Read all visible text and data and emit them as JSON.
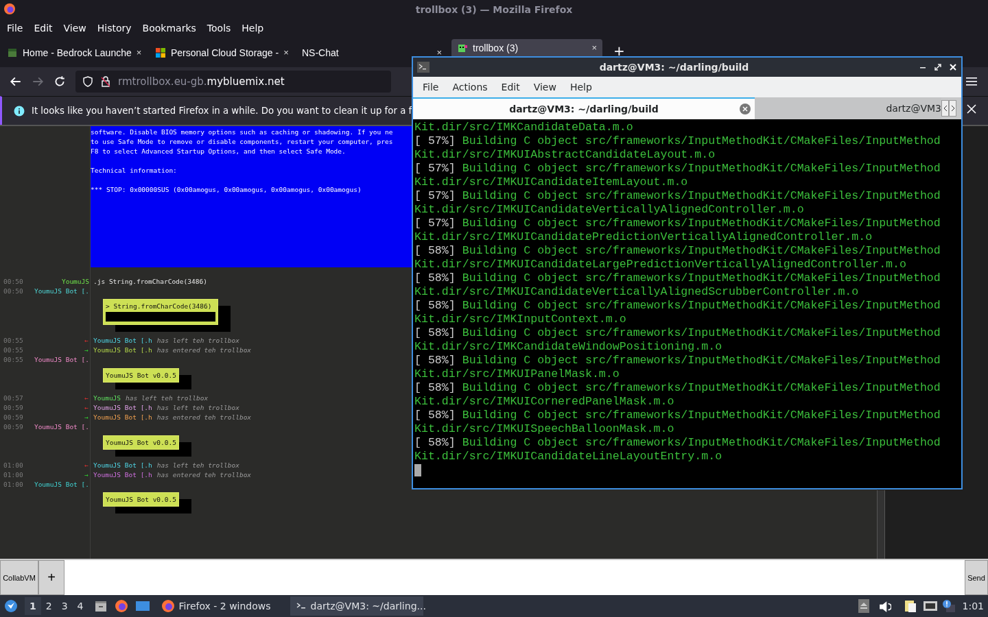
{
  "firefox": {
    "title": "trollbox (3) — Mozilla Firefox",
    "menu": [
      "File",
      "Edit",
      "View",
      "History",
      "Bookmarks",
      "Tools",
      "Help"
    ],
    "tabs": [
      {
        "label": "Home - Bedrock Launche",
        "close": "×",
        "selected": false
      },
      {
        "label": "Personal Cloud Storage -",
        "close": "×",
        "selected": false
      },
      {
        "label": "NS-Chat",
        "close": "×",
        "selected": false
      },
      {
        "label": "trollbox (3)",
        "close": "×",
        "selected": true
      }
    ],
    "new_tab": "+",
    "url_prefix": "rmtrollbox.eu-gb.",
    "url_domain": "mybluemix.net",
    "notice": "It looks like you haven’t started Firefox in a while. Do you want to clean it up for a f"
  },
  "chat": {
    "bsod_paragraphs": [
      [
        "software. Disable BIOS memory options such as caching or shadowing. If you ne",
        "to use Safe Mode to remove or disable components, restart your computer, pres",
        "F8 to select Advanced Startup Options, and then select Safe Mode."
      ],
      [
        "Technical information:"
      ],
      [
        "*** STOP: 0x00000SUS (0x00amogus, 0x00amogus, 0x00amogus, 0x00amogus)"
      ]
    ],
    "rows": [
      {
        "kind": "message",
        "time": "00:50",
        "name": "YoumuJS",
        "color": "#6ee04a",
        "text": ".js String.fromCharCode(3486)"
      },
      {
        "kind": "message",
        "time": "00:50",
        "name": "YoumuJS Bot [.",
        "color": "#4fd6d6",
        "text": ""
      },
      {
        "kind": "console",
        "text": "> String.fromCharCode(3486)"
      },
      {
        "kind": "left",
        "time": "00:55",
        "arrow": "←",
        "name": "YoumuJS Bot [.h",
        "color": "#4fd6e6",
        "text": "has left teh trollbox"
      },
      {
        "kind": "entered",
        "time": "00:55",
        "arrow": "→",
        "name": "YoumuJS Bot [.h",
        "color": "#b4d84a",
        "text": "has entered teh trollbox"
      },
      {
        "kind": "message",
        "time": "00:55",
        "name": "YoumuJS Bot [.",
        "color": "#f08ac8",
        "text": ""
      },
      {
        "kind": "card",
        "text": "YoumuJS Bot v0.0.5"
      },
      {
        "kind": "left",
        "time": "00:57",
        "arrow": "←",
        "name": "YoumuJS",
        "color": "#5fe05f",
        "text": "has left teh trollbox"
      },
      {
        "kind": "left",
        "time": "00:59",
        "arrow": "←",
        "name": "YoumuJS Bot [.h",
        "color": "#e0a0e8",
        "text": "has left teh trollbox"
      },
      {
        "kind": "entered",
        "time": "00:59",
        "arrow": "→",
        "name": "YoumuJS Bot [.h",
        "color": "#f0a050",
        "text": "has entered teh trollbox"
      },
      {
        "kind": "message",
        "time": "00:59",
        "name": "YoumuJS Bot [.",
        "color": "#f08ac8",
        "text": ""
      },
      {
        "kind": "card",
        "text": "YoumuJS Bot v0.0.5"
      },
      {
        "kind": "left",
        "time": "01:00",
        "arrow": "←",
        "name": "YoumuJS Bot [.h",
        "color": "#4fd6e6",
        "text": "has left teh trollbox"
      },
      {
        "kind": "entered",
        "time": "01:00",
        "arrow": "→",
        "name": "YoumuJS Bot [.h",
        "color": "#d070e0",
        "text": "has entered teh trollbox"
      },
      {
        "kind": "message",
        "time": "01:00",
        "name": "YoumuJS Bot [.",
        "color": "#40d0d0",
        "text": ""
      },
      {
        "kind": "card",
        "text": "YoumuJS Bot v0.0.5"
      }
    ],
    "room_button": "CollabVM",
    "add_button": "+",
    "send_button": "Send"
  },
  "terminal": {
    "title": "dartz@VM3: ~/darling/build",
    "menu": [
      "File",
      "Actions",
      "Edit",
      "View",
      "Help"
    ],
    "tabs": [
      {
        "label": "dartz@VM3: ~/darling/build",
        "selected": true
      },
      {
        "label": "dartz@VM3",
        "selected": false
      }
    ],
    "lines": [
      {
        "text": "Kit.dir/src/IMKCandidateData.m.o"
      },
      {
        "progress": "[ 57%]",
        "text": "Building C object src/frameworks/InputMethodKit/CMakeFiles/InputMethod"
      },
      {
        "text": "Kit.dir/src/IMKUIAbstractCandidateLayout.m.o"
      },
      {
        "progress": "[ 57%]",
        "text": "Building C object src/frameworks/InputMethodKit/CMakeFiles/InputMethod"
      },
      {
        "text": "Kit.dir/src/IMKUICandidateItemLayout.m.o"
      },
      {
        "progress": "[ 57%]",
        "text": "Building C object src/frameworks/InputMethodKit/CMakeFiles/InputMethod"
      },
      {
        "text": "Kit.dir/src/IMKUICandidateVerticallyAlignedController.m.o"
      },
      {
        "progress": "[ 57%]",
        "text": "Building C object src/frameworks/InputMethodKit/CMakeFiles/InputMethod"
      },
      {
        "text": "Kit.dir/src/IMKUICandidatePredictionVerticallyAlignedController.m.o"
      },
      {
        "progress": "[ 58%]",
        "text": "Building C object src/frameworks/InputMethodKit/CMakeFiles/InputMethod"
      },
      {
        "text": "Kit.dir/src/IMKUICandidateLargePredictionVerticallyAlignedController.m.o"
      },
      {
        "progress": "[ 58%]",
        "text": "Building C object src/frameworks/InputMethodKit/CMakeFiles/InputMethod"
      },
      {
        "text": "Kit.dir/src/IMKUICandidateVerticallyAlignedScrubberController.m.o"
      },
      {
        "progress": "[ 58%]",
        "text": "Building C object src/frameworks/InputMethodKit/CMakeFiles/InputMethod"
      },
      {
        "text": "Kit.dir/src/IMKInputContext.m.o"
      },
      {
        "progress": "[ 58%]",
        "text": "Building C object src/frameworks/InputMethodKit/CMakeFiles/InputMethod"
      },
      {
        "text": "Kit.dir/src/IMKCandidateWindowPositioning.m.o"
      },
      {
        "progress": "[ 58%]",
        "text": "Building C object src/frameworks/InputMethodKit/CMakeFiles/InputMethod"
      },
      {
        "text": "Kit.dir/src/IMKUIPanelMask.m.o"
      },
      {
        "progress": "[ 58%]",
        "text": "Building C object src/frameworks/InputMethodKit/CMakeFiles/InputMethod"
      },
      {
        "text": "Kit.dir/src/IMKUICorneredPanelMask.m.o"
      },
      {
        "progress": "[ 58%]",
        "text": "Building C object src/frameworks/InputMethodKit/CMakeFiles/InputMethod"
      },
      {
        "text": "Kit.dir/src/IMKUISpeechBalloonMask.m.o"
      },
      {
        "progress": "[ 58%]",
        "text": "Building C object src/frameworks/InputMethodKit/CMakeFiles/InputMethod"
      },
      {
        "text": "Kit.dir/src/IMKUICandidateLineLayoutEntry.m.o"
      }
    ]
  },
  "taskbar": {
    "workspaces": [
      {
        "label": "1",
        "selected": true
      },
      {
        "label": "2",
        "selected": false
      },
      {
        "label": "3",
        "selected": false
      },
      {
        "label": "4",
        "selected": false
      }
    ],
    "tasks": [
      {
        "label": "Firefox - 2 windows",
        "selected": false
      },
      {
        "label": "dartz@VM3: ~/darling...",
        "selected": true
      }
    ],
    "clock": "1:01"
  }
}
